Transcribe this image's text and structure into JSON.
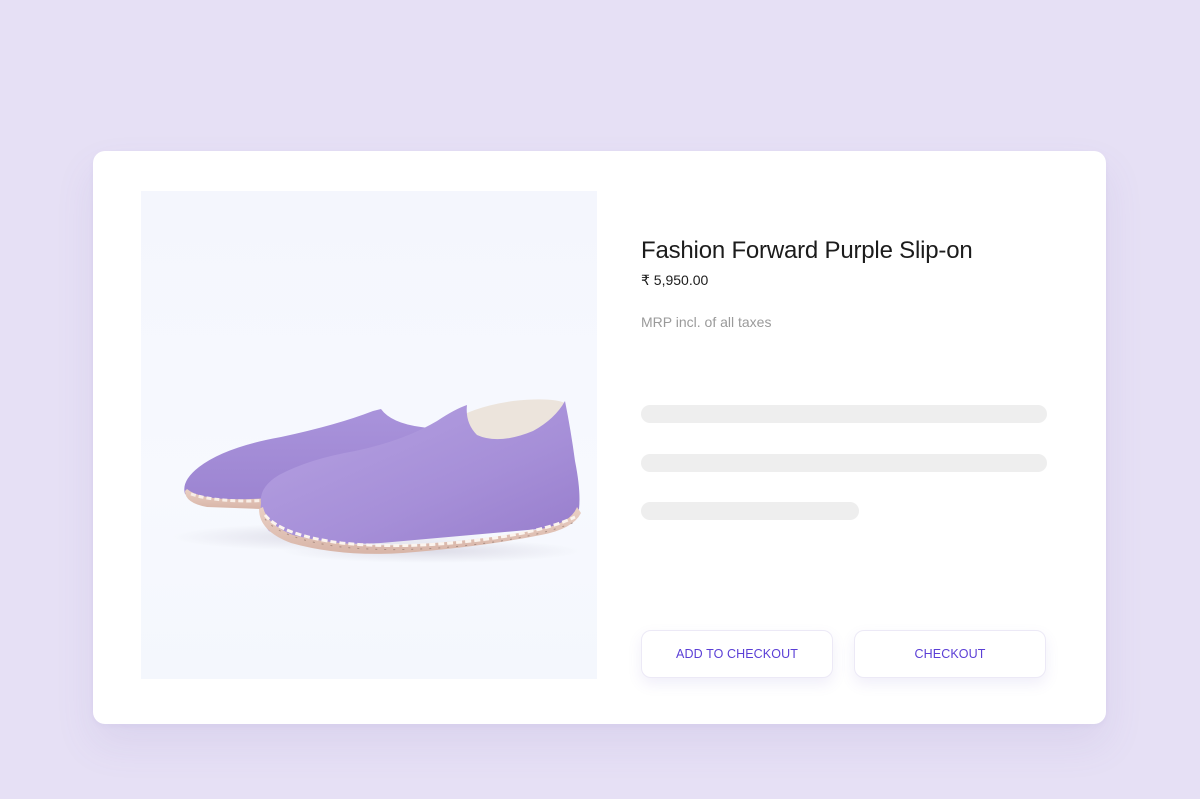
{
  "product": {
    "name": "Fashion Forward Purple Slip-on",
    "price": "₹ 5,950.00",
    "tax_note": "MRP incl. of all taxes",
    "image_alt": "purple suede slip-on shoes"
  },
  "actions": {
    "add_to_checkout_label": "ADD TO CHECKOUT",
    "checkout_label": "CHECKOUT"
  },
  "colors": {
    "page_background": "#e6e0f5",
    "accent": "#5b3fd6",
    "shoe": "#a58fd7",
    "skeleton": "#eeeeee"
  }
}
